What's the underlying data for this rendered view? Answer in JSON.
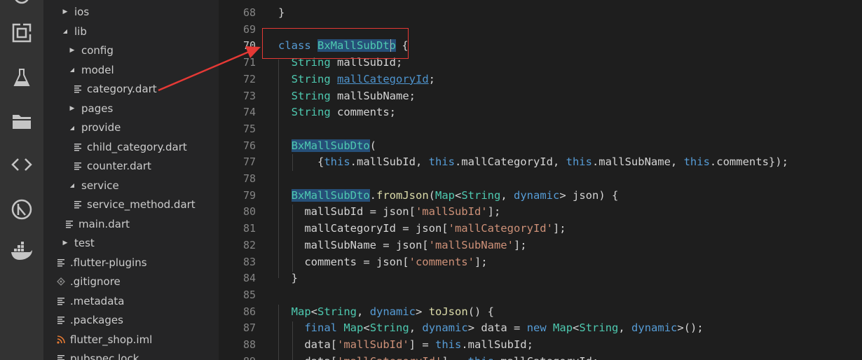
{
  "colors": {
    "activity_bg": "#333333",
    "sidebar_bg": "#252526",
    "editor_bg": "#1e1e1e",
    "annotation": "#e53935"
  },
  "activity_bar": {
    "icons": [
      "source-control-icon",
      "extensions-icon",
      "test-flask-icon",
      "folder-icon",
      "remote-explorer-icon",
      "flutter-icon",
      "docker-icon"
    ]
  },
  "sidebar": {
    "items": [
      {
        "label": "ios",
        "kind": "folder",
        "expanded": false,
        "depth": 1
      },
      {
        "label": "lib",
        "kind": "folder",
        "expanded": true,
        "depth": 1
      },
      {
        "label": "config",
        "kind": "folder",
        "expanded": false,
        "depth": 2
      },
      {
        "label": "model",
        "kind": "folder",
        "expanded": true,
        "depth": 2
      },
      {
        "label": "category.dart",
        "kind": "file",
        "depth": 3
      },
      {
        "label": "pages",
        "kind": "folder",
        "expanded": false,
        "depth": 2
      },
      {
        "label": "provide",
        "kind": "folder",
        "expanded": true,
        "depth": 2
      },
      {
        "label": "child_category.dart",
        "kind": "file",
        "depth": 3
      },
      {
        "label": "counter.dart",
        "kind": "file",
        "depth": 3
      },
      {
        "label": "service",
        "kind": "folder",
        "expanded": true,
        "depth": 2
      },
      {
        "label": "service_method.dart",
        "kind": "file",
        "depth": 3
      },
      {
        "label": "main.dart",
        "kind": "file",
        "depth": 2
      },
      {
        "label": "test",
        "kind": "folder",
        "expanded": false,
        "depth": 1
      },
      {
        "label": ".flutter-plugins",
        "kind": "file",
        "depth": 1
      },
      {
        "label": ".gitignore",
        "kind": "git",
        "depth": 1
      },
      {
        "label": ".metadata",
        "kind": "file",
        "depth": 1
      },
      {
        "label": ".packages",
        "kind": "file",
        "depth": 1
      },
      {
        "label": "flutter_shop.iml",
        "kind": "rss",
        "depth": 1
      },
      {
        "label": "pubspec.lock",
        "kind": "file",
        "depth": 1
      }
    ]
  },
  "editor": {
    "active_line": "70",
    "lines": [
      {
        "n": "68",
        "t": [
          [
            "}",
            "pu"
          ]
        ]
      },
      {
        "n": "69",
        "t": []
      },
      {
        "n": "70",
        "t": [
          [
            "class ",
            "kw"
          ],
          [
            "BxMallSubDto",
            "hlu"
          ],
          [
            " {",
            "pu"
          ]
        ]
      },
      {
        "n": "71",
        "t": [
          [
            "  ",
            ""
          ],
          [
            "String",
            "ty"
          ],
          [
            " mallSubId;",
            "pu"
          ]
        ]
      },
      {
        "n": "72",
        "t": [
          [
            "  ",
            ""
          ],
          [
            "String",
            "ty"
          ],
          [
            " ",
            ""
          ],
          [
            "mallCategoryId",
            "lnk"
          ],
          [
            ";",
            "pu"
          ]
        ]
      },
      {
        "n": "73",
        "t": [
          [
            "  ",
            ""
          ],
          [
            "String",
            "ty"
          ],
          [
            " mallSubName;",
            "pu"
          ]
        ]
      },
      {
        "n": "74",
        "t": [
          [
            "  ",
            ""
          ],
          [
            "String",
            "ty"
          ],
          [
            " comments;",
            "pu"
          ]
        ]
      },
      {
        "n": "75",
        "t": []
      },
      {
        "n": "76",
        "t": [
          [
            "  ",
            ""
          ],
          [
            "BxMallSubDto",
            "hlu"
          ],
          [
            "(",
            "pu"
          ]
        ]
      },
      {
        "n": "77",
        "t": [
          [
            "      {",
            "pu"
          ],
          [
            "this",
            "kw"
          ],
          [
            ".mallSubId, ",
            "pu"
          ],
          [
            "this",
            "kw"
          ],
          [
            ".mallCategoryId, ",
            "pu"
          ],
          [
            "this",
            "kw"
          ],
          [
            ".mallSubName, ",
            "pu"
          ],
          [
            "this",
            "kw"
          ],
          [
            ".comments});",
            "pu"
          ]
        ]
      },
      {
        "n": "78",
        "t": []
      },
      {
        "n": "79",
        "t": [
          [
            "  ",
            ""
          ],
          [
            "BxMallSubDto",
            "hlu"
          ],
          [
            ".",
            "pu"
          ],
          [
            "fromJson",
            "fn"
          ],
          [
            "(",
            "pu"
          ],
          [
            "Map",
            "ty"
          ],
          [
            "<",
            "pu"
          ],
          [
            "String",
            "ty"
          ],
          [
            ", ",
            "pu"
          ],
          [
            "dynamic",
            "kw"
          ],
          [
            "> json) {",
            "pu"
          ]
        ]
      },
      {
        "n": "80",
        "t": [
          [
            "    mallSubId = json[",
            "pu"
          ],
          [
            "'mallSubId'",
            "st"
          ],
          [
            "];",
            "pu"
          ]
        ]
      },
      {
        "n": "81",
        "t": [
          [
            "    mallCategoryId = json[",
            "pu"
          ],
          [
            "'mallCategoryId'",
            "st"
          ],
          [
            "];",
            "pu"
          ]
        ]
      },
      {
        "n": "82",
        "t": [
          [
            "    mallSubName = json[",
            "pu"
          ],
          [
            "'mallSubName'",
            "st"
          ],
          [
            "];",
            "pu"
          ]
        ]
      },
      {
        "n": "83",
        "t": [
          [
            "    comments = json[",
            "pu"
          ],
          [
            "'comments'",
            "st"
          ],
          [
            "];",
            "pu"
          ]
        ]
      },
      {
        "n": "84",
        "t": [
          [
            "  }",
            "pu"
          ]
        ]
      },
      {
        "n": "85",
        "t": []
      },
      {
        "n": "86",
        "t": [
          [
            "  ",
            ""
          ],
          [
            "Map",
            "ty"
          ],
          [
            "<",
            "pu"
          ],
          [
            "String",
            "ty"
          ],
          [
            ", ",
            "pu"
          ],
          [
            "dynamic",
            "kw"
          ],
          [
            "> ",
            "pu"
          ],
          [
            "toJson",
            "fn"
          ],
          [
            "() {",
            "pu"
          ]
        ]
      },
      {
        "n": "87",
        "t": [
          [
            "    ",
            ""
          ],
          [
            "final",
            "kw"
          ],
          [
            " ",
            ""
          ],
          [
            "Map",
            "ty"
          ],
          [
            "<",
            "pu"
          ],
          [
            "String",
            "ty"
          ],
          [
            ", ",
            "pu"
          ],
          [
            "dynamic",
            "kw"
          ],
          [
            "> data = ",
            "pu"
          ],
          [
            "new",
            "kw"
          ],
          [
            " ",
            ""
          ],
          [
            "Map",
            "ty"
          ],
          [
            "<",
            "pu"
          ],
          [
            "String",
            "ty"
          ],
          [
            ", ",
            "pu"
          ],
          [
            "dynamic",
            "kw"
          ],
          [
            ">();",
            "pu"
          ]
        ]
      },
      {
        "n": "88",
        "t": [
          [
            "    data[",
            "pu"
          ],
          [
            "'mallSubId'",
            "st"
          ],
          [
            "] = ",
            "pu"
          ],
          [
            "this",
            "kw"
          ],
          [
            ".mallSubId;",
            "pu"
          ]
        ]
      },
      {
        "n": "89",
        "t": [
          [
            "    data[",
            "pu"
          ],
          [
            "'mallCategoryId'",
            "st"
          ],
          [
            "] = ",
            "pu"
          ],
          [
            "this",
            "kw"
          ],
          [
            ".mallCategoryId;",
            "pu"
          ]
        ]
      }
    ]
  }
}
